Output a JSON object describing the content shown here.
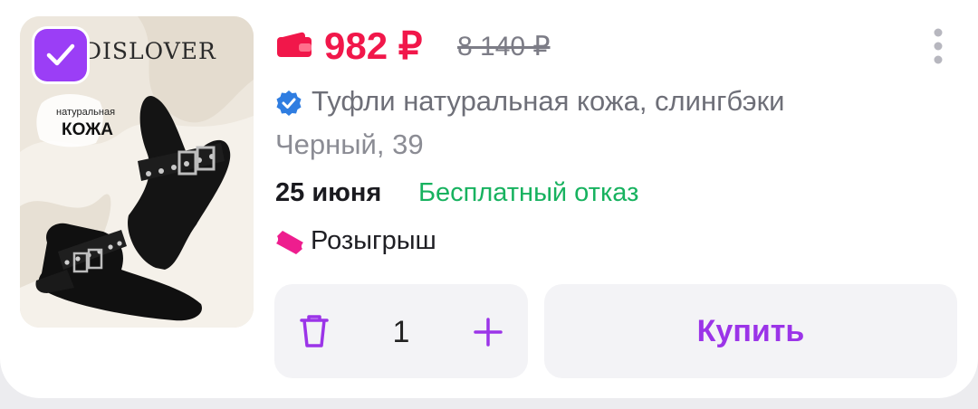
{
  "product": {
    "brand": "DISLOVER",
    "badge_small": "натуральная",
    "badge_big": "КОЖА",
    "selected": true,
    "image_icon": "product-photo-black-slingback-shoes"
  },
  "price": {
    "current": "982 ₽",
    "old": "8 140 ₽",
    "wallet_icon": "wallet-icon",
    "color": "#f1174a"
  },
  "title": "Туфли натуральная кожа, слингбэки",
  "variant": "Черный, 39",
  "delivery": {
    "date": "25 июня",
    "free_return": "Бесплатный отказ",
    "free_color": "#17b25f"
  },
  "promo": {
    "label": "Розыгрыш",
    "icon": "ticket-icon"
  },
  "cart": {
    "quantity": "1",
    "buy_label": "Купить",
    "accent": "#9b34e8"
  }
}
